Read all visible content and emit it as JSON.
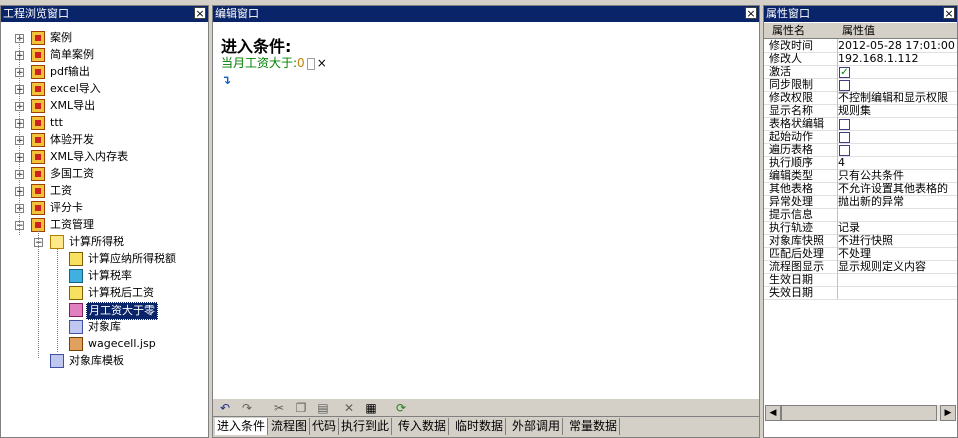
{
  "left_pane": {
    "title": "工程浏览窗口"
  },
  "tree": {
    "top_items": [
      "案例",
      "简单案例",
      "pdf输出",
      "excel导入",
      "XML导出",
      "ttt",
      "体验开发",
      "XML导入内存表",
      "多国工资",
      "工资",
      "评分卡",
      "工资管理"
    ],
    "sub_folder": "计算所得税",
    "leaves": [
      "计算应纳所得税额",
      "计算税率",
      "计算税后工资",
      "月工资大于零"
    ],
    "siblings": [
      "对象库",
      "wagecell.jsp"
    ],
    "last": "对象库模板"
  },
  "editor": {
    "title": "编辑窗口",
    "heading": "进入条件:",
    "condition_label": "当月工资大于:",
    "condition_value": "0",
    "close_mark": "×",
    "tabs": [
      "进入条件",
      "流程图",
      "代码",
      "执行到此",
      "传入数据",
      "临时数据",
      "外部调用",
      "常量数据"
    ]
  },
  "props": {
    "title": "属性窗口",
    "col_name": "属性名",
    "col_value": "属性值",
    "rows": [
      {
        "name": "修改时间",
        "value": "2012-05-28 17:01:00"
      },
      {
        "name": "修改人",
        "value": "192.168.1.112"
      },
      {
        "name": "激活",
        "value": "",
        "checked": true
      },
      {
        "name": "同步限制",
        "value": "",
        "checked": false
      },
      {
        "name": "修改权限",
        "value": "不控制编辑和显示权限"
      },
      {
        "name": "显示名称",
        "value": "规则集"
      },
      {
        "name": "表格状编辑",
        "value": "",
        "checked": false
      },
      {
        "name": "起始动作",
        "value": "",
        "checked": false
      },
      {
        "name": "遍历表格",
        "value": "",
        "checked": false
      },
      {
        "name": "执行顺序",
        "value": "4"
      },
      {
        "name": "编辑类型",
        "value": "只有公共条件"
      },
      {
        "name": "其他表格",
        "value": "不允许设置其他表格的"
      },
      {
        "name": "异常处理",
        "value": "抛出新的异常"
      },
      {
        "name": "提示信息",
        "value": ""
      },
      {
        "name": "执行轨迹",
        "value": "记录"
      },
      {
        "name": "对象库快照",
        "value": "不进行快照"
      },
      {
        "name": "匹配后处理",
        "value": "不处理"
      },
      {
        "name": "流程图显示",
        "value": "显示规则定义内容"
      },
      {
        "name": "生效日期",
        "value": ""
      },
      {
        "name": "失效日期",
        "value": ""
      }
    ]
  },
  "colors": {
    "title_bar": "#0a246a",
    "condition_text": "#008000"
  }
}
